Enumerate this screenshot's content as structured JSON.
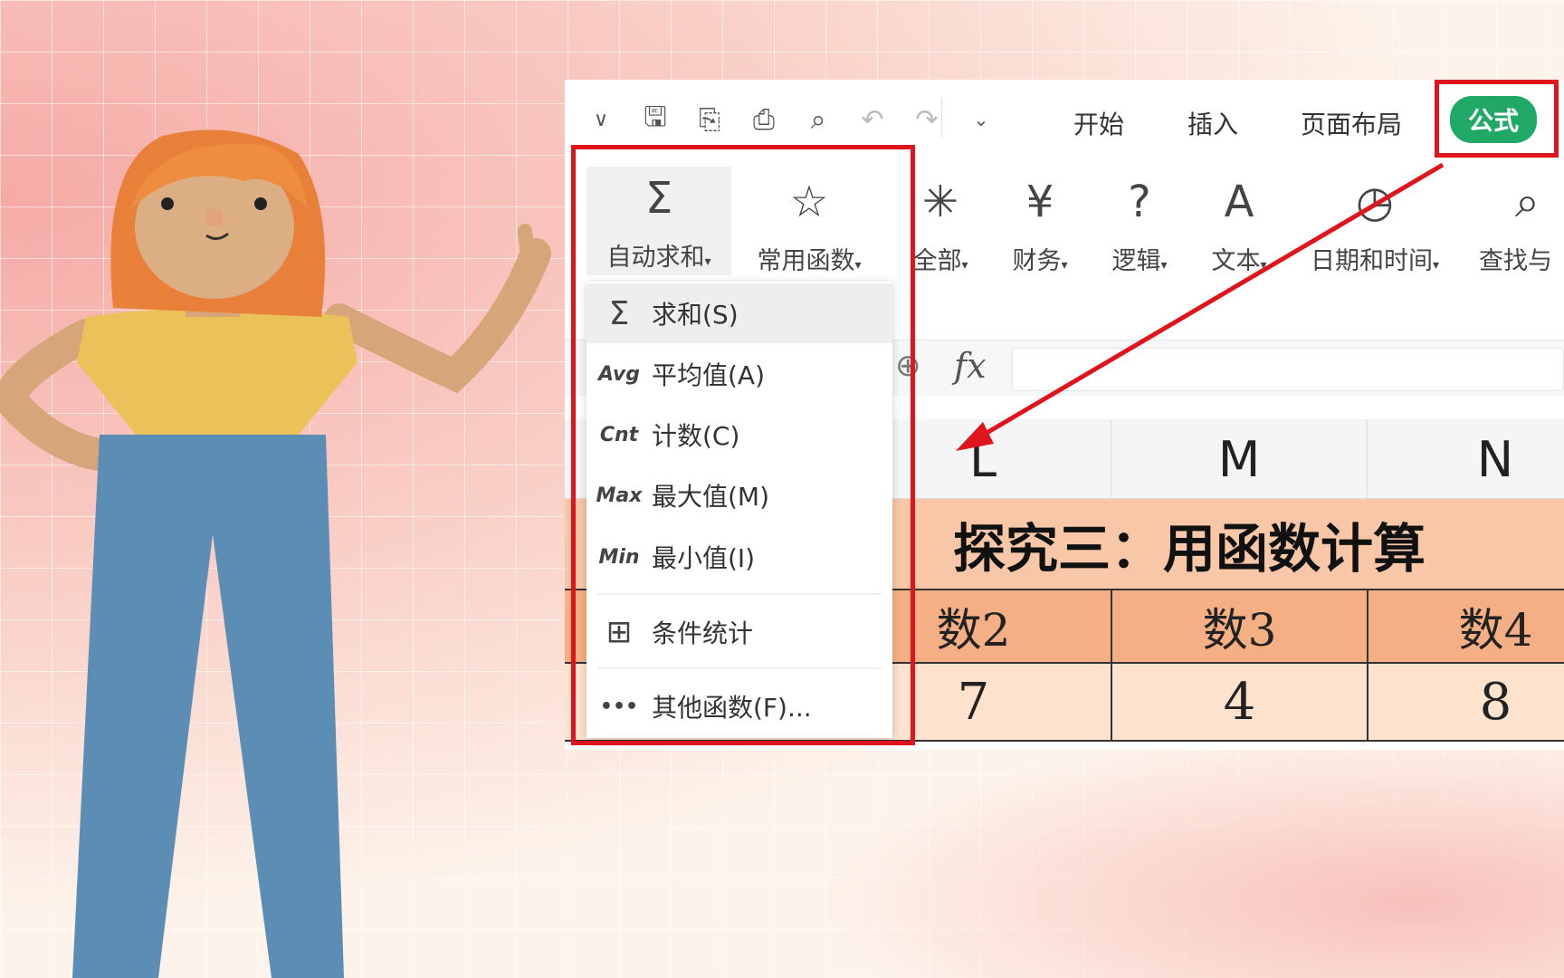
{
  "quick_access": {
    "icons": [
      "chevron-down-icon",
      "save-icon",
      "export-icon",
      "print-icon",
      "print-preview-icon",
      "undo-icon",
      "redo-icon",
      "customize-icon"
    ]
  },
  "tabs": [
    {
      "label": "开始"
    },
    {
      "label": "插入"
    },
    {
      "label": "页面布局"
    },
    {
      "label": "公式",
      "active": true
    }
  ],
  "ribbon": [
    {
      "label": "自动求和",
      "icon": "Σ"
    },
    {
      "label": "常用函数",
      "icon": "☆"
    },
    {
      "label": "全部",
      "icon": "✳"
    },
    {
      "label": "财务",
      "icon": "¥"
    },
    {
      "label": "逻辑",
      "icon": "?"
    },
    {
      "label": "文本",
      "icon": "A"
    },
    {
      "label": "日期和时间",
      "icon": "◷"
    },
    {
      "label": "查找与",
      "icon": "⌕"
    }
  ],
  "dropdown_arrow": "▾",
  "menu": {
    "items": [
      {
        "icon": "Σ",
        "label": "求和(S)"
      },
      {
        "icon": "Avg",
        "label": "平均值(A)"
      },
      {
        "icon": "Cnt",
        "label": "计数(C)"
      },
      {
        "icon": "Max",
        "label": "最大值(M)"
      },
      {
        "icon": "Min",
        "label": "最小值(I)"
      },
      {
        "icon": "⊞",
        "label": "条件统计"
      },
      {
        "icon": "•••",
        "label": "其他函数(F)..."
      }
    ]
  },
  "formula_bar": {
    "fx": "fx",
    "value": ""
  },
  "sheet": {
    "columns": [
      "L",
      "M",
      "N"
    ],
    "title": "探究三：用函数计算",
    "headers": [
      "数2",
      "数3",
      "数4"
    ],
    "values": [
      "7",
      "4",
      "8"
    ]
  },
  "colors": {
    "accent": "#1fa866",
    "highlight": "#e0141c",
    "title_fill": "#f8c7a8",
    "header_fill": "#f4b084",
    "data_fill": "#fde2cd"
  }
}
